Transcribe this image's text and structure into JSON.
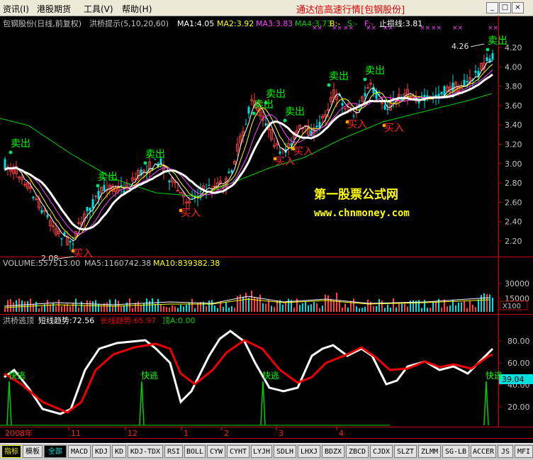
{
  "menu": {
    "items": [
      "资讯(I)",
      "港股期货",
      "工具(V)",
      "帮助(H)"
    ],
    "window_title": "通达信高速行情[包钢股份]",
    "minimize": "_",
    "maximize": "□",
    "close": "×"
  },
  "main_panel": {
    "stock_name": "包钢股份(日线,前复权)",
    "indicator_name": "洪桥提示(5,10,20,60)",
    "ma1": "MA1:4.05",
    "ma2": "MA2:3.92",
    "ma3": "MA3:3.83",
    "ma4": "MA4:3.73",
    "b": "B:-",
    "s": "S:-",
    "f": "F:-",
    "stop_loss": "止损线:3.81",
    "y_ticks": [
      "4.20",
      "4.00",
      "3.80",
      "3.60",
      "3.40",
      "3.20",
      "3.00",
      "2.80",
      "2.60",
      "2.40",
      "2.20"
    ],
    "high_label": "4.26",
    "low_label": "2.08",
    "watermark_title": "第一股票公式网",
    "watermark_url": "www.chnmoney.com",
    "sell_label": "卖出",
    "buy_label": "买入"
  },
  "volume_panel": {
    "volume": "VOLUME:557513.00",
    "ma5": "MA5:1160742.38",
    "ma10": "MA10:839382.38",
    "y_ticks": [
      "30000",
      "15000"
    ],
    "unit": "X100"
  },
  "osc_panel": {
    "name": "洪桥逃顶",
    "short_trend": "短线趋势:72.56",
    "long_trend": "长线趋势:65.97",
    "top": "顶A:0.00",
    "y_ticks": [
      "80.00",
      "60.00",
      "40.00",
      "20.00"
    ],
    "current_value": "39.04",
    "escape_label": "快逃"
  },
  "time_axis": [
    "2008年",
    "11",
    "12",
    "1",
    "2",
    "3",
    "4"
  ],
  "tabs": [
    "指标",
    "模板",
    "全部",
    "MACD",
    "KDJ",
    "KD",
    "KDJ-TDX",
    "RSI",
    "BOLL",
    "CYW",
    "CYHT",
    "LYJH",
    "SDLH",
    "LHXJ",
    "BDZX",
    "ZBCD",
    "CJDX",
    "SLZT",
    "ZLMM",
    "SG-LB",
    "ACCER",
    "JS",
    "MFI"
  ],
  "colors": {
    "up": "#ff4040",
    "down": "#00e0e0",
    "ma1": "#ffffff",
    "ma2": "#ffff00",
    "ma3": "#ff40ff",
    "ma4": "#00d000",
    "short_trend": "#ffffff",
    "long_trend": "#ee0000",
    "axis": "#c00000",
    "watermark": "#ffff00"
  }
}
